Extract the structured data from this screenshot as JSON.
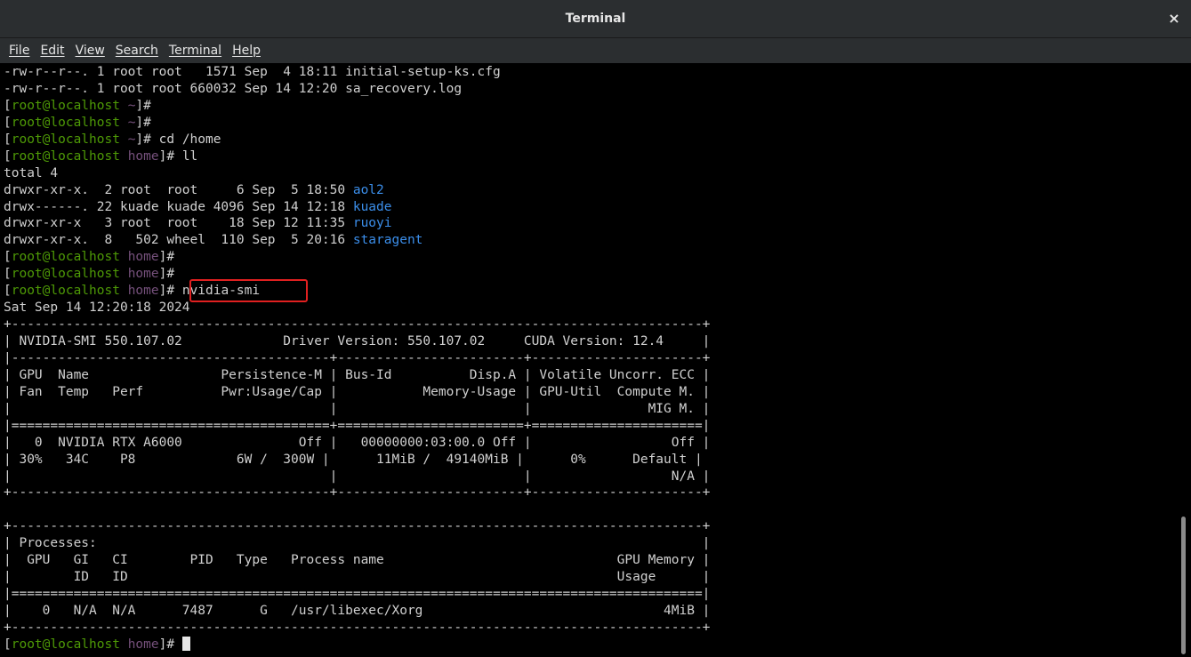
{
  "window": {
    "title": "Terminal",
    "close_glyph": "×"
  },
  "menu": [
    "File",
    "Edit",
    "View",
    "Search",
    "Terminal",
    "Help"
  ],
  "prompt": {
    "open": "[",
    "user_host": "root@localhost",
    "home_dir": "~",
    "home_path": "home",
    "close": "]# "
  },
  "lines": [
    {
      "type": "text",
      "text": "-rw-r--r--. 1 root root   1571 Sep  4 18:11 initial-setup-ks.cfg"
    },
    {
      "type": "text",
      "text": "-rw-r--r--. 1 root root 660032 Sep 14 12:20 sa_recovery.log"
    },
    {
      "type": "prompt",
      "dir": "~",
      "cmd": ""
    },
    {
      "type": "prompt",
      "dir": "~",
      "cmd": ""
    },
    {
      "type": "prompt",
      "dir": "~",
      "cmd": "cd /home"
    },
    {
      "type": "prompt",
      "dir": "home",
      "cmd": "ll"
    },
    {
      "type": "text",
      "text": "total 4"
    },
    {
      "type": "ls",
      "text": "drwxr-xr-x.  2 root  root     6 Sep  5 18:50 ",
      "name": "aol2"
    },
    {
      "type": "ls",
      "text": "drwx------. 22 kuade kuade 4096 Sep 14 12:18 ",
      "name": "kuade"
    },
    {
      "type": "ls",
      "text": "drwxr-xr-x   3 root  root    18 Sep 12 11:35 ",
      "name": "ruoyi"
    },
    {
      "type": "ls",
      "text": "drwxr-xr-x.  8   502 wheel  110 Sep  5 20:16 ",
      "name": "staragent"
    },
    {
      "type": "prompt",
      "dir": "home",
      "cmd": ""
    },
    {
      "type": "prompt",
      "dir": "home",
      "cmd": ""
    },
    {
      "type": "prompt",
      "dir": "home",
      "cmd": "nvidia-smi"
    },
    {
      "type": "text",
      "text": "Sat Sep 14 12:20:18 2024"
    },
    {
      "type": "text",
      "text": "+-----------------------------------------------------------------------------------------+"
    },
    {
      "type": "text",
      "text": "| NVIDIA-SMI 550.107.02             Driver Version: 550.107.02     CUDA Version: 12.4     |"
    },
    {
      "type": "text",
      "text": "|-----------------------------------------+------------------------+----------------------+"
    },
    {
      "type": "text",
      "text": "| GPU  Name                 Persistence-M | Bus-Id          Disp.A | Volatile Uncorr. ECC |"
    },
    {
      "type": "text",
      "text": "| Fan  Temp   Perf          Pwr:Usage/Cap |           Memory-Usage | GPU-Util  Compute M. |"
    },
    {
      "type": "text",
      "text": "|                                         |                        |               MIG M. |"
    },
    {
      "type": "text",
      "text": "|=========================================+========================+======================|"
    },
    {
      "type": "text",
      "text": "|   0  NVIDIA RTX A6000               Off |   00000000:03:00.0 Off |                  Off |"
    },
    {
      "type": "text",
      "text": "| 30%   34C    P8             6W /  300W |      11MiB /  49140MiB |      0%      Default |"
    },
    {
      "type": "text",
      "text": "|                                         |                        |                  N/A |"
    },
    {
      "type": "text",
      "text": "+-----------------------------------------+------------------------+----------------------+"
    },
    {
      "type": "text",
      "text": ""
    },
    {
      "type": "text",
      "text": "+-----------------------------------------------------------------------------------------+"
    },
    {
      "type": "text",
      "text": "| Processes:                                                                              |"
    },
    {
      "type": "text",
      "text": "|  GPU   GI   CI        PID   Type   Process name                              GPU Memory |"
    },
    {
      "type": "text",
      "text": "|        ID   ID                                                               Usage      |"
    },
    {
      "type": "text",
      "text": "|=========================================================================================|"
    },
    {
      "type": "text",
      "text": "|    0   N/A  N/A      7487      G   /usr/libexec/Xorg                               4MiB |"
    },
    {
      "type": "text",
      "text": "+-----------------------------------------------------------------------------------------+"
    },
    {
      "type": "prompt",
      "dir": "home",
      "cmd": "",
      "cursor": true
    }
  ],
  "colors": {
    "user_host": "#4e9a06",
    "directory_path": "#75507b",
    "ls_dir_name": "#3b8eea",
    "highlight_box": "#e02020",
    "text": "#d0d0d0",
    "background": "#000000"
  }
}
